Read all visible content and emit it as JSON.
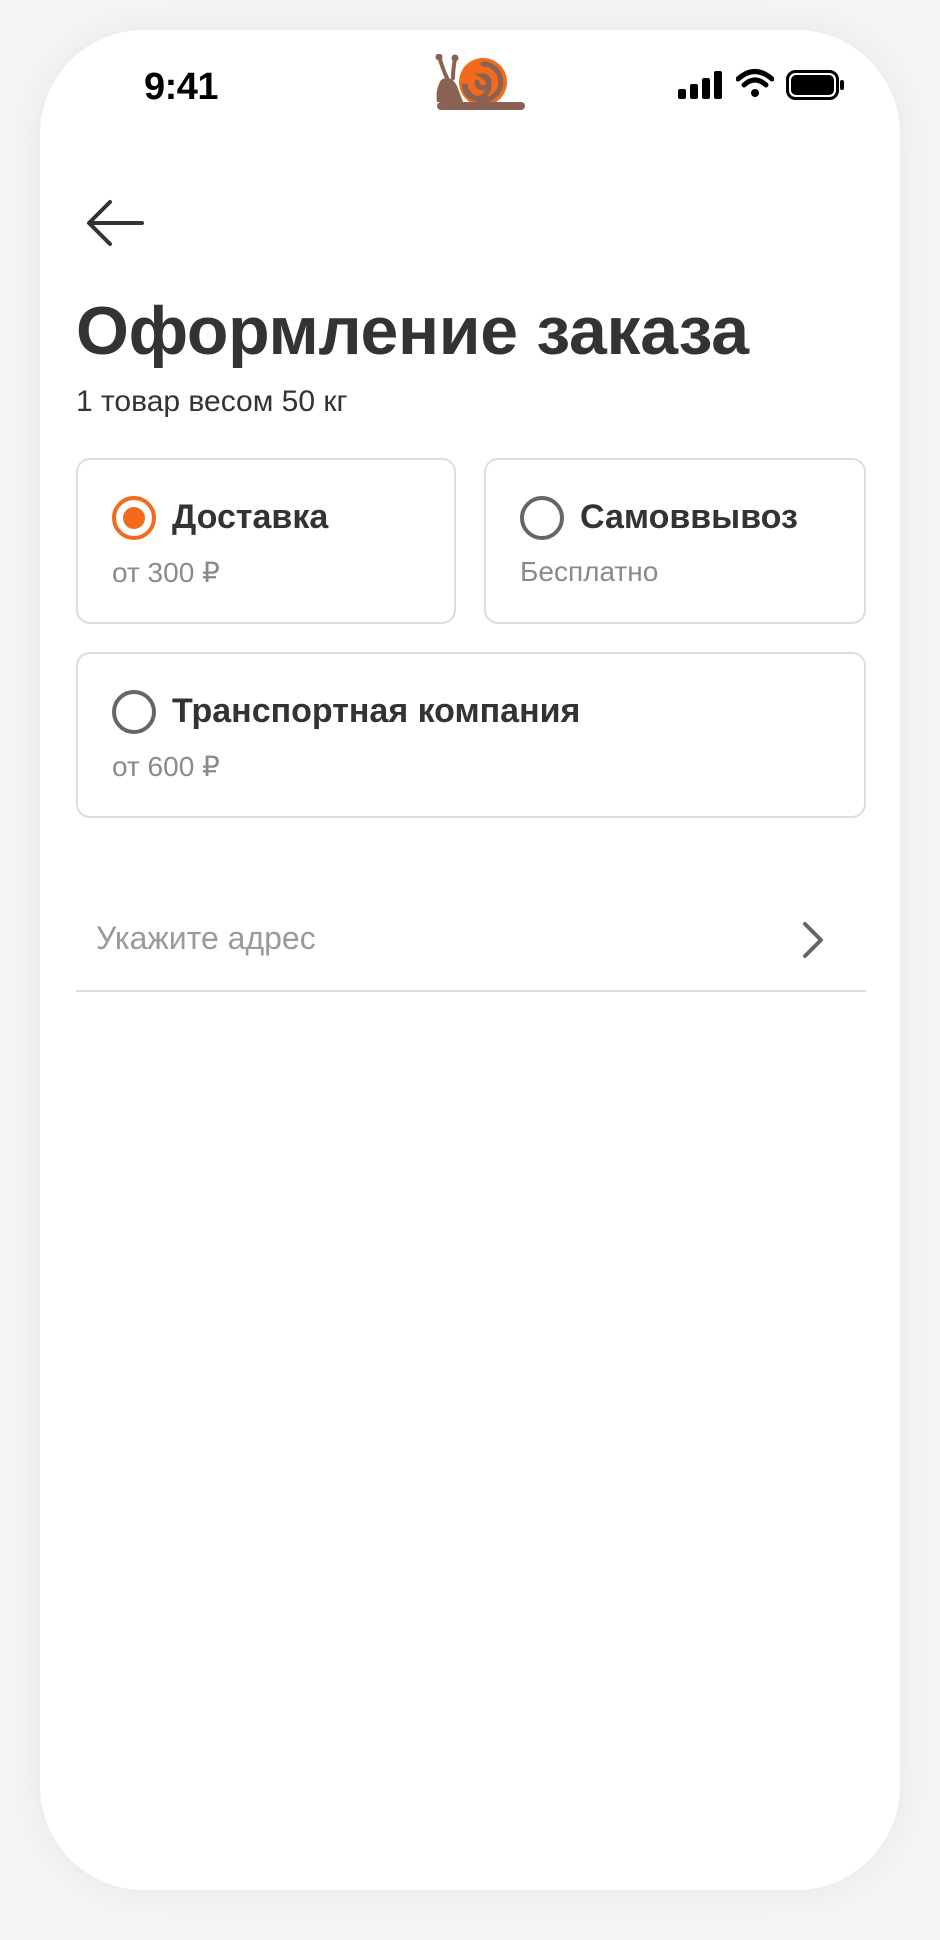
{
  "status_bar": {
    "time": "9:41",
    "icons": [
      "snail-logo-icon",
      "cellular-signal-icon",
      "wifi-icon",
      "battery-icon"
    ]
  },
  "header": {
    "back_icon": "arrow-left-icon",
    "title": "Оформление заказа",
    "subtitle": "1 товар весом 50 кг"
  },
  "delivery_options": [
    {
      "label": "Доставка",
      "price": "от 300 ₽",
      "selected": true
    },
    {
      "label": "Самоввывоз",
      "price": "Бесплатно",
      "selected": false
    },
    {
      "label": "Транспортная компания",
      "price": "от 600 ₽",
      "selected": false
    }
  ],
  "address": {
    "placeholder": "Укажите адрес",
    "icon": "chevron-right-icon"
  },
  "colors": {
    "accent": "#f26a1b",
    "text": "#333333",
    "muted": "#8a8a8a",
    "border": "#dddddd",
    "logo_brown": "#8a6253"
  }
}
